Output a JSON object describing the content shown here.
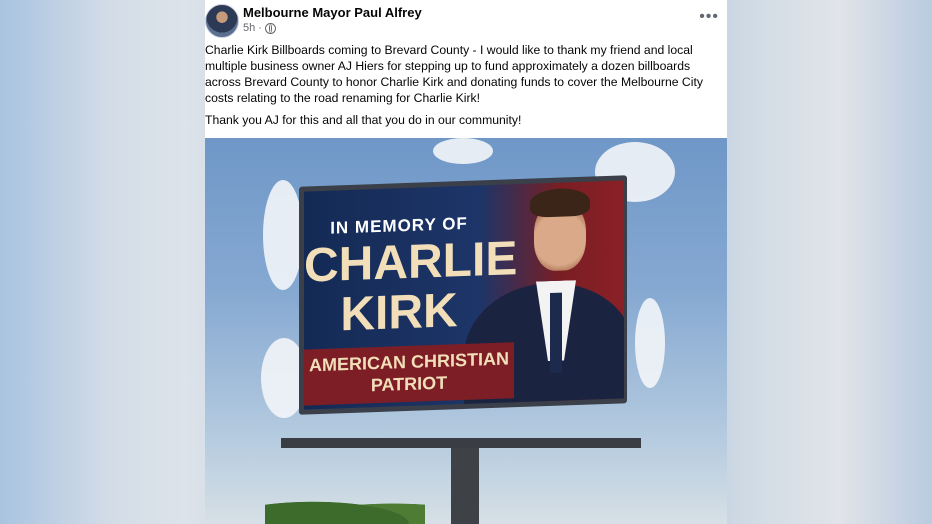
{
  "post": {
    "author": "Melbourne Mayor Paul Alfrey",
    "time": "5h",
    "separator": "·",
    "privacy_icon": "globe-icon",
    "more_icon": "more-options-icon",
    "more_label": "•••",
    "paragraphs": [
      "Charlie Kirk Billboards coming to Brevard County - I would like to thank my friend and local multiple business owner AJ Hiers for stepping up to fund approximately a dozen billboards across Brevard County to honor Charlie Kirk and donating funds to cover the Melbourne City costs relating to the road renaming for Charlie Kirk!",
      "Thank you AJ for this and all that you do in our community!"
    ],
    "image": {
      "billboard_line1": "IN MEMORY OF",
      "billboard_line2": "CHARLIE KIRK",
      "billboard_line3": "AMERICAN CHRISTIAN PATRIOT"
    }
  },
  "colors": {
    "billboard_navy": "#1d3568",
    "billboard_red": "#7d1e26",
    "billboard_cream": "#f2dfb9"
  }
}
